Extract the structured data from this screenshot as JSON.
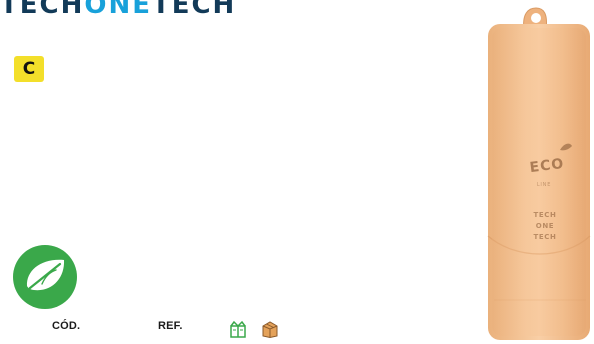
{
  "brand": {
    "part1": "TECH",
    "part2": "ONE",
    "part3": "TECH"
  },
  "badge": {
    "letter": "C",
    "color": "#f3df2a"
  },
  "icons": {
    "eco": "leaf-icon",
    "pack_green": "green-gift-box-icon",
    "pack_brown": "brown-carton-box-icon"
  },
  "labels": {
    "cod": "CÓD.",
    "ref": "REF."
  },
  "product": {
    "logo": "ECO",
    "logo_sub": "LINE",
    "brand_lines": [
      "TECH",
      "ONE",
      "TECH"
    ]
  },
  "colors": {
    "brand_dark": "#123a58",
    "brand_accent": "#18a1da",
    "eco_green": "#3aa84a",
    "product": "#efb887"
  }
}
